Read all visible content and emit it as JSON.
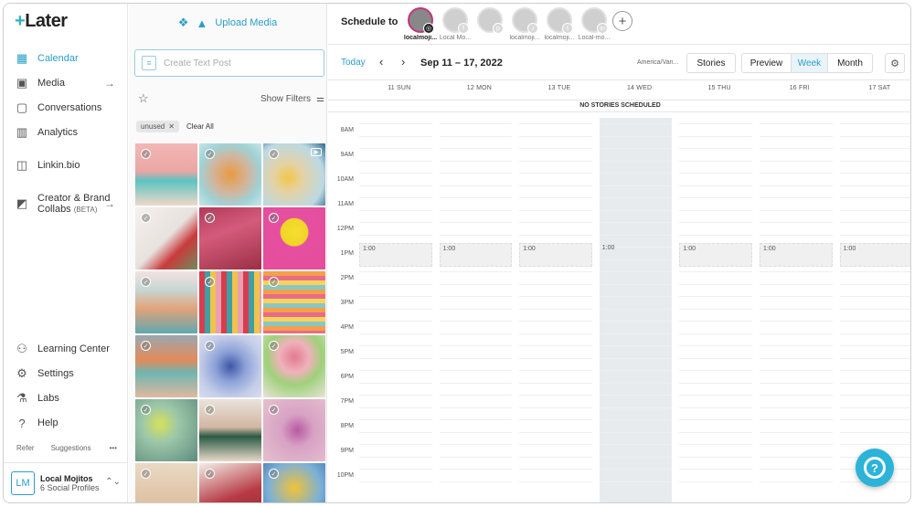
{
  "app": {
    "logo_text": "Later",
    "logo_plus": "+"
  },
  "sidebar": {
    "items": [
      {
        "label": "Calendar",
        "icon": "calendar-icon",
        "glyph": "▦",
        "active": true,
        "arrow": ""
      },
      {
        "label": "Media",
        "icon": "image-icon",
        "glyph": "▣",
        "active": false,
        "arrow": "→"
      },
      {
        "label": "Conversations",
        "icon": "chat-icon",
        "glyph": "▢",
        "active": false,
        "arrow": ""
      },
      {
        "label": "Analytics",
        "icon": "bar-chart-icon",
        "glyph": "▥",
        "active": false,
        "arrow": ""
      },
      {
        "label": "Linkin.bio",
        "icon": "link-icon",
        "glyph": "◫",
        "active": false,
        "arrow": ""
      },
      {
        "label": "Creator & Brand",
        "label2": "Collabs",
        "beta": "(BETA)",
        "icon": "collabs-icon",
        "glyph": "◩",
        "active": false,
        "arrow": "→"
      }
    ],
    "bottom_items": [
      {
        "label": "Learning Center",
        "icon": "learning-icon",
        "glyph": "⚇"
      },
      {
        "label": "Settings",
        "icon": "gear-icon",
        "glyph": "⚙"
      },
      {
        "label": "Labs",
        "icon": "flask-icon",
        "glyph": "⚗"
      },
      {
        "label": "Help",
        "icon": "help-icon",
        "glyph": "?"
      }
    ],
    "refer_label": "Refer",
    "suggestions_label": "Suggestions",
    "more_label": "•••",
    "profile": {
      "initials": "LM",
      "name": "Local Mojitos",
      "sub": "6 Social Profiles",
      "toggle": "⌃⌄"
    }
  },
  "media_panel": {
    "upload_label": "Upload Media",
    "text_post_placeholder": "Create Text Post",
    "show_filters": "Show Filters",
    "tag": "unused",
    "clear_all": "Clear All",
    "tiles": [
      {
        "bg": "linear-gradient(180deg,#f3b7b5 0%,#e9a7a4 45%,#5cc3c2 60%,#f1d7c8 100%)",
        "video": false
      },
      {
        "bg": "radial-gradient(circle at 50% 50%,#e89a42 0%,#d3b49a 40%,#9fd2d6 70%,#c8e6e6 100%)",
        "video": false
      },
      {
        "bg": "radial-gradient(circle at 40% 55%,#f2c74b 0%,#e3d2a7 30%,#bcd9e3 70%,#2a6b8e 100%)",
        "video": true
      },
      {
        "bg": "linear-gradient(135deg,#f4f1ee 0%,#e8e2de 50%,#c93b3b 70%,#6f8b5c 100%)",
        "video": false
      },
      {
        "bg": "linear-gradient(160deg,#b13a5b 0%,#d45b7b 40%,#9b2f46 100%)",
        "video": false
      },
      {
        "bg": "radial-gradient(circle at 50% 40%,#f7df2d 0%,#f0d429 28%,#e64fa0 30%,#e34e9b 100%)",
        "video": false
      },
      {
        "bg": "linear-gradient(180deg,#f1e3e2 0%,#c7d6d4 30%,#e3a27a 60%,#5fa8b0 100%)",
        "video": false
      },
      {
        "bg": "repeating-linear-gradient(90deg,#d93c4c 0 6px,#3ca0a6 6px 12px,#f0c34a 12px 18px,#e8a0b3 18px 24px)",
        "video": false
      },
      {
        "bg": "repeating-linear-gradient(180deg,#f4a04b 0 5px,#e76c88 5px 10px,#f8d35b 10px 15px,#8ac6c4 15px 20px)",
        "video": false
      },
      {
        "bg": "linear-gradient(180deg,#9aa7b0 0%,#e38b5a 40%,#6fb5b0 60%,#e0b8a0 100%)",
        "video": false
      },
      {
        "bg": "radial-gradient(circle at 50% 50%,#3f57a6 0%,#8ea2d8 35%,#c4cde8 70%,#d9dcee 100%)",
        "video": false
      },
      {
        "bg": "radial-gradient(circle at 50% 35%,#e27a92 0%,#f0b1bb 30%,#9fd17a 55%,#e9e3d8 100%)",
        "video": false
      },
      {
        "bg": "radial-gradient(circle at 40% 40%,#d7e25a 0%,#9dc7a9 35%,#5e8a7e 100%)",
        "video": false
      },
      {
        "bg": "linear-gradient(180deg,#eae3dc 0%,#d2b6a2 45%,#2b5a45 60%,#e8d8c8 100%)",
        "video": false
      },
      {
        "bg": "radial-gradient(circle at 55% 50%,#b75aa3 0%,#d7a2c4 35%,#e5c0ce 100%)",
        "video": false
      },
      {
        "bg": "linear-gradient(180deg,#e9d9c4 0%,#d8b48f 100%)",
        "video": false
      },
      {
        "bg": "linear-gradient(160deg,#f3eee6 0%,#b73a45 55%,#8c2a35 100%)",
        "video": false
      },
      {
        "bg": "radial-gradient(circle at 50% 40%,#f2c23a 0%,#7ab0d8 55%,#3e6ea4 100%)",
        "video": false
      }
    ]
  },
  "topbar": {
    "schedule_label": "Schedule to",
    "accounts": [
      {
        "label": "localmoji...",
        "net": "instagram-icon",
        "glyph": "◎",
        "selected": true
      },
      {
        "label": "Local Mo...",
        "net": "facebook-icon",
        "glyph": "f",
        "selected": false
      },
      {
        "label": "",
        "net": "pinterest-icon",
        "glyph": "p",
        "selected": false
      },
      {
        "label": "localmoji...",
        "net": "tiktok-icon",
        "glyph": "♪",
        "selected": false
      },
      {
        "label": "localmoji...",
        "net": "twitter-icon",
        "glyph": "t",
        "selected": false
      },
      {
        "label": "Local-mo...",
        "net": "linkedin-icon",
        "glyph": "in",
        "selected": false
      }
    ],
    "add_glyph": "+"
  },
  "calendar_toolbar": {
    "today": "Today",
    "prev": "‹",
    "next": "›",
    "date_range": "Sep 11 – 17, 2022",
    "timezone": "America/Van...",
    "stories": "Stories",
    "views": [
      {
        "label": "Preview",
        "active": false
      },
      {
        "label": "Week",
        "active": true
      },
      {
        "label": "Month",
        "active": false
      }
    ],
    "settings_glyph": "⚙"
  },
  "calendar": {
    "days": [
      "11 SUN",
      "12 MON",
      "13 TUE",
      "14 WED",
      "15 THU",
      "16 FRI",
      "17 SAT"
    ],
    "today_index": 3,
    "no_stories": "NO STORIES SCHEDULED",
    "hours": [
      "8AM",
      "9AM",
      "10AM",
      "11AM",
      "12PM",
      "1PM",
      "2PM",
      "3PM",
      "4PM",
      "5PM",
      "6PM",
      "7PM",
      "8PM",
      "9PM",
      "10PM"
    ],
    "event_label": "1:00",
    "event_hour_index": 5
  },
  "help_fab": {
    "glyph": "?"
  },
  "colors": {
    "accent": "#2a9ec8",
    "today_col": "#e8ebee"
  }
}
